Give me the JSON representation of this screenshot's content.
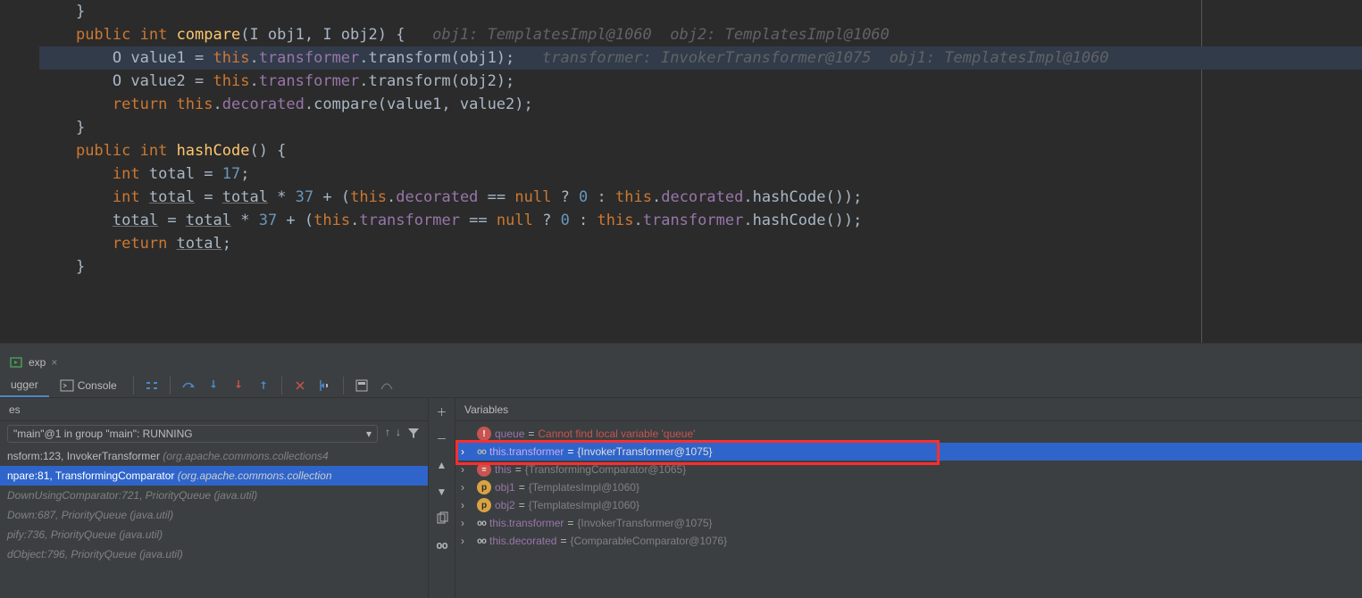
{
  "editor": {
    "lines": [
      {
        "indent": "    ",
        "tokens": [
          {
            "t": "}",
            "c": "paren"
          }
        ]
      },
      {
        "indent": "",
        "tokens": []
      },
      {
        "indent": "    ",
        "tokens": [
          {
            "t": "public ",
            "c": "kw"
          },
          {
            "t": "int ",
            "c": "kw"
          },
          {
            "t": "compare",
            "c": "fn"
          },
          {
            "t": "(I obj1, I obj2) {   ",
            "c": "typ"
          },
          {
            "t": "obj1: TemplatesImpl@1060  obj2: TemplatesImpl@1060",
            "c": "hint"
          }
        ]
      },
      {
        "indent": "        ",
        "highlight": true,
        "tokens": [
          {
            "t": "O value1 = ",
            "c": "typ"
          },
          {
            "t": "this",
            "c": "this-kw"
          },
          {
            "t": ".",
            "c": "typ"
          },
          {
            "t": "transformer",
            "c": "field"
          },
          {
            "t": ".transform(obj1);   ",
            "c": "typ"
          },
          {
            "t": "transformer: InvokerTransformer@1075  obj1: TemplatesImpl@1060",
            "c": "hint"
          }
        ]
      },
      {
        "indent": "        ",
        "tokens": [
          {
            "t": "O value2 = ",
            "c": "typ"
          },
          {
            "t": "this",
            "c": "this-kw"
          },
          {
            "t": ".",
            "c": "typ"
          },
          {
            "t": "transformer",
            "c": "field"
          },
          {
            "t": ".transform(obj2);",
            "c": "typ"
          }
        ]
      },
      {
        "indent": "        ",
        "tokens": [
          {
            "t": "return ",
            "c": "kw"
          },
          {
            "t": "this",
            "c": "this-kw"
          },
          {
            "t": ".",
            "c": "typ"
          },
          {
            "t": "decorated",
            "c": "field"
          },
          {
            "t": ".compare(value1, value2);",
            "c": "typ"
          }
        ]
      },
      {
        "indent": "    ",
        "tokens": [
          {
            "t": "}",
            "c": "paren"
          }
        ]
      },
      {
        "indent": "",
        "tokens": []
      },
      {
        "indent": "    ",
        "tokens": [
          {
            "t": "public ",
            "c": "kw"
          },
          {
            "t": "int ",
            "c": "kw"
          },
          {
            "t": "hashCode",
            "c": "fn"
          },
          {
            "t": "() {",
            "c": "typ"
          }
        ]
      },
      {
        "indent": "        ",
        "tokens": [
          {
            "t": "int ",
            "c": "kw"
          },
          {
            "t": "total = ",
            "c": "typ"
          },
          {
            "t": "17",
            "c": "num"
          },
          {
            "t": ";",
            "c": "typ"
          }
        ]
      },
      {
        "indent": "        ",
        "tokens": [
          {
            "t": "int ",
            "c": "kw"
          },
          {
            "t": "total",
            "c": "under"
          },
          {
            "t": " = ",
            "c": "typ"
          },
          {
            "t": "total",
            "c": "under"
          },
          {
            "t": " * ",
            "c": "typ"
          },
          {
            "t": "37",
            "c": "num"
          },
          {
            "t": " + (",
            "c": "typ"
          },
          {
            "t": "this",
            "c": "this-kw"
          },
          {
            "t": ".",
            "c": "typ"
          },
          {
            "t": "decorated",
            "c": "field"
          },
          {
            "t": " == ",
            "c": "typ"
          },
          {
            "t": "null ",
            "c": "kw"
          },
          {
            "t": "? ",
            "c": "typ"
          },
          {
            "t": "0",
            "c": "num"
          },
          {
            "t": " : ",
            "c": "typ"
          },
          {
            "t": "this",
            "c": "this-kw"
          },
          {
            "t": ".",
            "c": "typ"
          },
          {
            "t": "decorated",
            "c": "field"
          },
          {
            "t": ".hashCode());",
            "c": "typ"
          }
        ]
      },
      {
        "indent": "        ",
        "tokens": [
          {
            "t": "total",
            "c": "under"
          },
          {
            "t": " = ",
            "c": "typ"
          },
          {
            "t": "total",
            "c": "under"
          },
          {
            "t": " * ",
            "c": "typ"
          },
          {
            "t": "37",
            "c": "num"
          },
          {
            "t": " + (",
            "c": "typ"
          },
          {
            "t": "this",
            "c": "this-kw"
          },
          {
            "t": ".",
            "c": "typ"
          },
          {
            "t": "transformer",
            "c": "field"
          },
          {
            "t": " == ",
            "c": "typ"
          },
          {
            "t": "null ",
            "c": "kw"
          },
          {
            "t": "? ",
            "c": "typ"
          },
          {
            "t": "0",
            "c": "num"
          },
          {
            "t": " : ",
            "c": "typ"
          },
          {
            "t": "this",
            "c": "this-kw"
          },
          {
            "t": ".",
            "c": "typ"
          },
          {
            "t": "transformer",
            "c": "field"
          },
          {
            "t": ".hashCode());",
            "c": "typ"
          }
        ]
      },
      {
        "indent": "        ",
        "tokens": [
          {
            "t": "return ",
            "c": "kw"
          },
          {
            "t": "total",
            "c": "under"
          },
          {
            "t": ";",
            "c": "typ"
          }
        ]
      },
      {
        "indent": "    ",
        "tokens": [
          {
            "t": "}",
            "c": "paren"
          }
        ]
      }
    ]
  },
  "run_tab": {
    "label": "exp"
  },
  "debug_toolbar": {
    "debugger_label": "ugger",
    "console_label": "Console"
  },
  "frames": {
    "header": "es",
    "dropdown": "\"main\"@1 in group \"main\": RUNNING",
    "list": [
      {
        "text": "nsform:123, InvokerTransformer",
        "pkg": "(org.apache.commons.collections4",
        "sel": false
      },
      {
        "text": "npare:81, TransformingComparator",
        "pkg": "(org.apache.commons.collection",
        "sel": true
      },
      {
        "text": "DownUsingComparator:721, PriorityQueue",
        "pkg": "(java.util)",
        "sel": false,
        "lib": true
      },
      {
        "text": "Down:687, PriorityQueue",
        "pkg": "(java.util)",
        "sel": false,
        "lib": true
      },
      {
        "text": "pify:736, PriorityQueue",
        "pkg": "(java.util)",
        "sel": false,
        "lib": true
      },
      {
        "text": "dObject:796, PriorityQueue",
        "pkg": "(java.util)",
        "sel": false,
        "lib": true
      }
    ]
  },
  "variables": {
    "header": "Variables",
    "list": [
      {
        "kind": "err",
        "name": "queue",
        "eq": " = ",
        "val": "Cannot find local variable 'queue'",
        "chev": "",
        "valcls": "var-err"
      },
      {
        "kind": "watch",
        "name": "this.transformer",
        "eq": " = ",
        "val": "{InvokerTransformer@1075}",
        "chev": "›",
        "sel": true,
        "boxed": true
      },
      {
        "kind": "that",
        "name": "this",
        "eq": " = ",
        "val": "{TransformingComparator@1065}",
        "chev": "›"
      },
      {
        "kind": "param",
        "name": "obj1",
        "eq": " = ",
        "val": "{TemplatesImpl@1060}",
        "chev": "›"
      },
      {
        "kind": "param",
        "name": "obj2",
        "eq": " = ",
        "val": "{TemplatesImpl@1060}",
        "chev": "›"
      },
      {
        "kind": "watch",
        "name": "this.transformer",
        "eq": " = ",
        "val": "{InvokerTransformer@1075}",
        "chev": "›"
      },
      {
        "kind": "watch",
        "name": "this.decorated",
        "eq": " = ",
        "val": "{ComparableComparator@1076}",
        "chev": "›"
      }
    ]
  }
}
